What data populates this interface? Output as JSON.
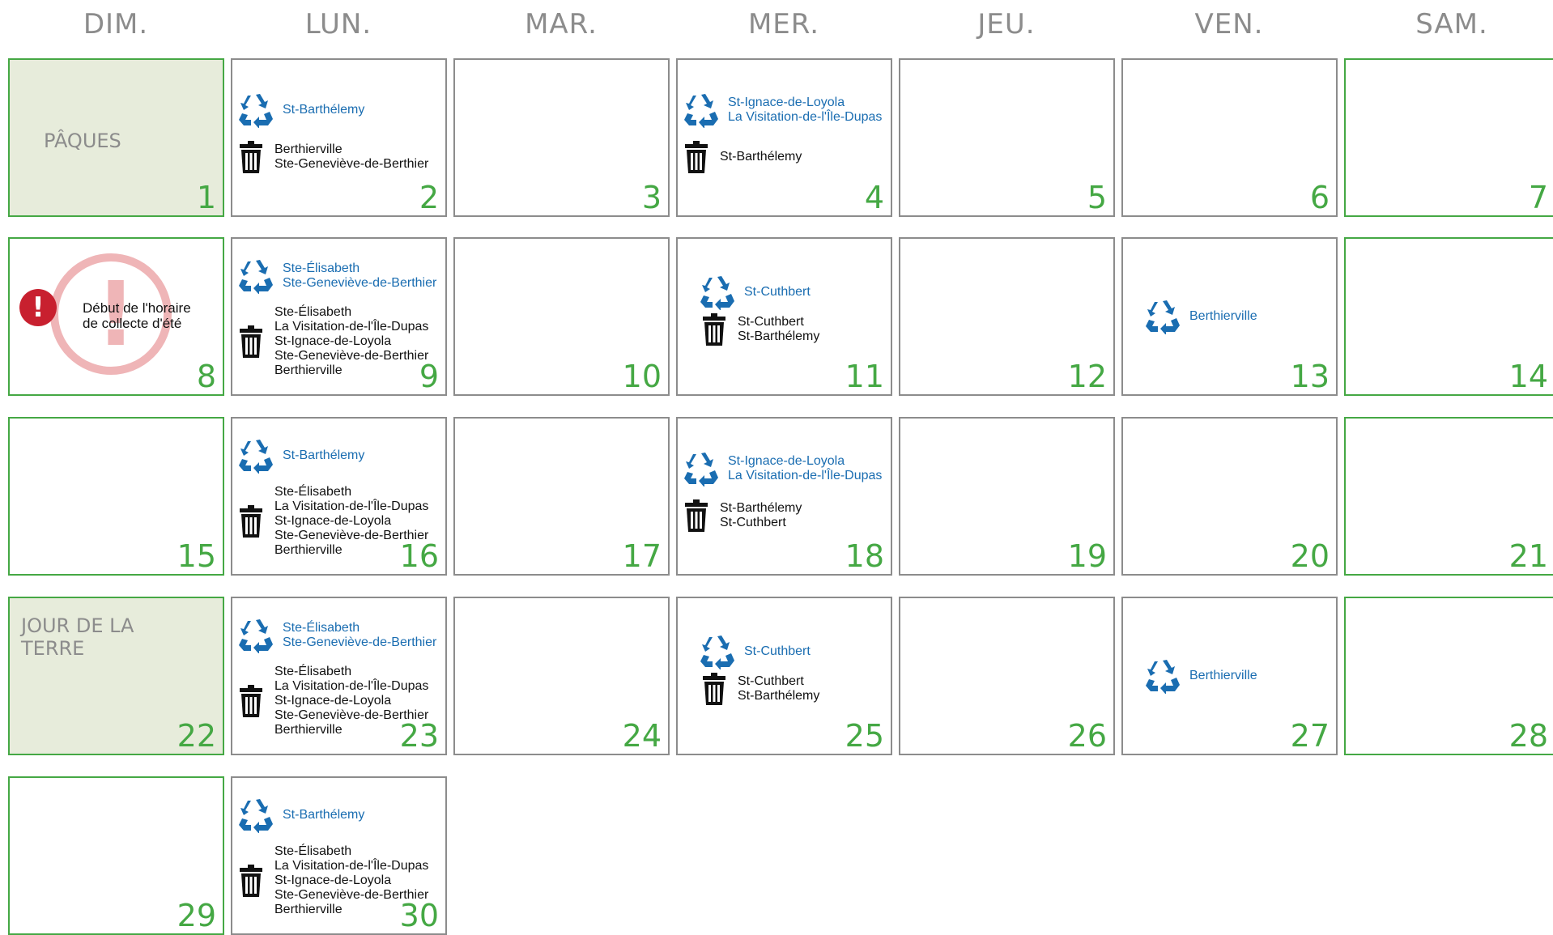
{
  "headers": [
    "DIM.",
    "LUN.",
    "MAR.",
    "MER.",
    "JEU.",
    "VEN.",
    "SAM."
  ],
  "colors": {
    "recycle": "#1a6db1",
    "green": "#45a844",
    "holiday_bg": "#e7ecdb",
    "gray": "#8c8c8c",
    "notice_red": "#c8202f"
  },
  "days": [
    {
      "d": "1",
      "label": "PÂQUES"
    },
    {
      "d": "2",
      "recycle": [
        "St-Barthélemy"
      ],
      "trash": [
        "Berthierville",
        "Ste-Geneviève-de-Berthier"
      ]
    },
    {
      "d": "3"
    },
    {
      "d": "4",
      "recycle": [
        "St-Ignace-de-Loyola",
        "La Visitation-de-l'Île-Dupas"
      ],
      "trash": [
        "St-Barthélemy"
      ]
    },
    {
      "d": "5"
    },
    {
      "d": "6"
    },
    {
      "d": "7"
    },
    {
      "d": "8",
      "notice": [
        "Début de l'horaire",
        "de collecte d'été"
      ]
    },
    {
      "d": "9",
      "recycle": [
        "Ste-Élisabeth",
        "Ste-Geneviève-de-Berthier"
      ],
      "trash": [
        "Ste-Élisabeth",
        "La Visitation-de-l'Île-Dupas",
        "St-Ignace-de-Loyola",
        "Ste-Geneviève-de-Berthier",
        "Berthierville"
      ]
    },
    {
      "d": "10"
    },
    {
      "d": "11",
      "recycle": [
        "St-Cuthbert"
      ],
      "trash": [
        "St-Cuthbert",
        "St-Barthélemy"
      ]
    },
    {
      "d": "12"
    },
    {
      "d": "13",
      "recycle": [
        "Berthierville"
      ]
    },
    {
      "d": "14"
    },
    {
      "d": "15"
    },
    {
      "d": "16",
      "recycle": [
        "St-Barthélemy"
      ],
      "trash": [
        "Ste-Élisabeth",
        "La Visitation-de-l'Île-Dupas",
        "St-Ignace-de-Loyola",
        "Ste-Geneviève-de-Berthier",
        "Berthierville"
      ]
    },
    {
      "d": "17"
    },
    {
      "d": "18",
      "recycle": [
        "St-Ignace-de-Loyola",
        "La Visitation-de-l'Île-Dupas"
      ],
      "trash": [
        "St-Barthélemy",
        "St-Cuthbert"
      ]
    },
    {
      "d": "19"
    },
    {
      "d": "20"
    },
    {
      "d": "21"
    },
    {
      "d": "22",
      "label": "JOUR DE LA TERRE"
    },
    {
      "d": "23",
      "recycle": [
        "Ste-Élisabeth",
        "Ste-Geneviève-de-Berthier"
      ],
      "trash": [
        "Ste-Élisabeth",
        "La Visitation-de-l'Île-Dupas",
        "St-Ignace-de-Loyola",
        "Ste-Geneviève-de-Berthier",
        "Berthierville"
      ]
    },
    {
      "d": "24"
    },
    {
      "d": "25",
      "recycle": [
        "St-Cuthbert"
      ],
      "trash": [
        "St-Cuthbert",
        "St-Barthélemy"
      ]
    },
    {
      "d": "26"
    },
    {
      "d": "27",
      "recycle": [
        "Berthierville"
      ]
    },
    {
      "d": "28"
    },
    {
      "d": "29"
    },
    {
      "d": "30",
      "recycle": [
        "St-Barthélemy"
      ],
      "trash": [
        "Ste-Élisabeth",
        "La Visitation-de-l'Île-Dupas",
        "St-Ignace-de-Loyola",
        "Ste-Geneviève-de-Berthier",
        "Berthierville"
      ]
    }
  ]
}
